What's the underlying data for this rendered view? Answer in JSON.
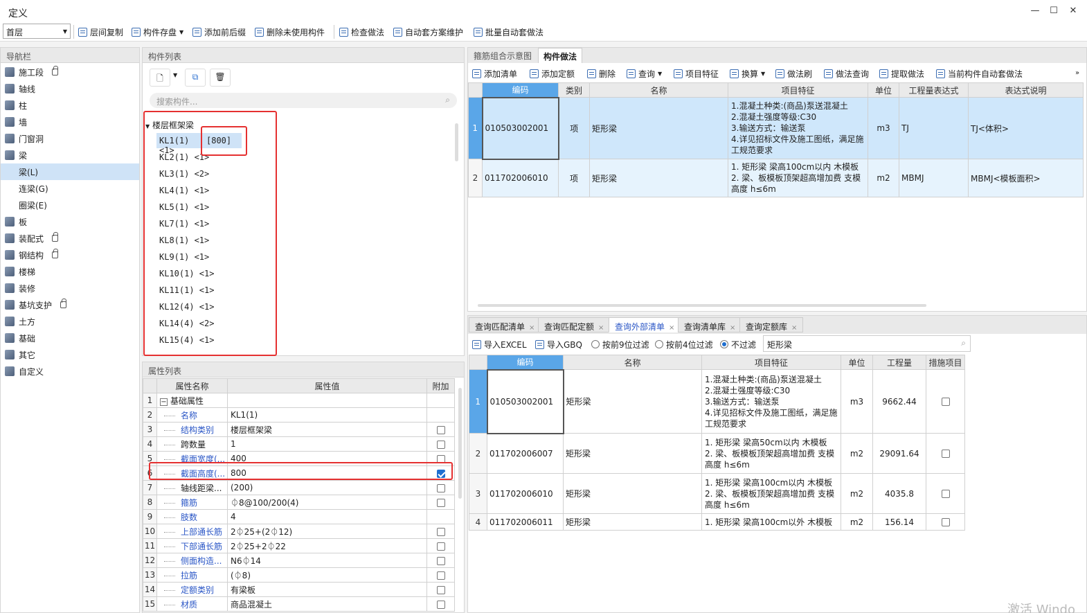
{
  "window": {
    "title": "定义"
  },
  "toolbar": {
    "floor_select": "首层",
    "buttons": [
      "层间复制",
      "构件存盘",
      "添加前后缀",
      "删除未使用构件",
      "检查做法",
      "自动套方案维护",
      "批量自动套做法"
    ]
  },
  "nav": {
    "title": "导航栏",
    "items": [
      {
        "label": "施工段",
        "lock": true,
        "sub": false,
        "selected": false
      },
      {
        "label": "轴线",
        "lock": false,
        "sub": false,
        "selected": false
      },
      {
        "label": "柱",
        "lock": false,
        "sub": false,
        "selected": false
      },
      {
        "label": "墙",
        "lock": false,
        "sub": false,
        "selected": false
      },
      {
        "label": "门窗洞",
        "lock": false,
        "sub": false,
        "selected": false
      },
      {
        "label": "梁",
        "lock": false,
        "sub": false,
        "selected": false
      },
      {
        "label": "梁(L)",
        "lock": false,
        "sub": true,
        "selected": true
      },
      {
        "label": "连梁(G)",
        "lock": false,
        "sub": true,
        "selected": false
      },
      {
        "label": "圈梁(E)",
        "lock": false,
        "sub": true,
        "selected": false
      },
      {
        "label": "板",
        "lock": false,
        "sub": false,
        "selected": false
      },
      {
        "label": "装配式",
        "lock": true,
        "sub": false,
        "selected": false
      },
      {
        "label": "钢结构",
        "lock": true,
        "sub": false,
        "selected": false
      },
      {
        "label": "楼梯",
        "lock": false,
        "sub": false,
        "selected": false
      },
      {
        "label": "装修",
        "lock": false,
        "sub": false,
        "selected": false
      },
      {
        "label": "基坑支护",
        "lock": true,
        "sub": false,
        "selected": false
      },
      {
        "label": "土方",
        "lock": false,
        "sub": false,
        "selected": false
      },
      {
        "label": "基础",
        "lock": false,
        "sub": false,
        "selected": false
      },
      {
        "label": "其它",
        "lock": false,
        "sub": false,
        "selected": false
      },
      {
        "label": "自定义",
        "lock": false,
        "sub": false,
        "selected": false
      }
    ]
  },
  "component_list": {
    "title": "构件列表",
    "search_placeholder": "搜索构件...",
    "group": "楼层框架梁",
    "selected_tag": "[800]",
    "items": [
      "KL1(1) <1>",
      "KL2(1) <1>",
      "KL3(1) <2>",
      "KL4(1) <1>",
      "KL5(1) <1>",
      "KL7(1) <1>",
      "KL8(1) <1>",
      "KL9(1) <1>",
      "KL10(1) <1>",
      "KL11(1) <1>",
      "KL12(4) <1>",
      "KL14(4) <2>",
      "KL15(4) <1>"
    ]
  },
  "props": {
    "title": "属性列表",
    "headers": [
      "属性名称",
      "属性值",
      "附加"
    ],
    "rows": [
      {
        "n": "1",
        "name": "基础属性",
        "val": "",
        "chk": "none",
        "blue": false,
        "group": true
      },
      {
        "n": "2",
        "name": "名称",
        "val": "KL1(1)",
        "chk": "none",
        "blue": true
      },
      {
        "n": "3",
        "name": "结构类别",
        "val": "楼层框架梁",
        "chk": "off",
        "blue": true
      },
      {
        "n": "4",
        "name": "跨数量",
        "val": "1",
        "chk": "off",
        "blue": false
      },
      {
        "n": "5",
        "name": "截面宽度(...",
        "val": "400",
        "chk": "off",
        "blue": true
      },
      {
        "n": "6",
        "name": "截面高度(...",
        "val": "800",
        "chk": "on",
        "blue": true
      },
      {
        "n": "7",
        "name": "轴线距梁...",
        "val": "(200)",
        "chk": "off",
        "blue": false
      },
      {
        "n": "8",
        "name": "箍筋",
        "val": "⏀8@100/200(4)",
        "chk": "off",
        "blue": true
      },
      {
        "n": "9",
        "name": "肢数",
        "val": "4",
        "chk": "none",
        "blue": true
      },
      {
        "n": "10",
        "name": "上部通长筋",
        "val": "2⏀25+(2⏀12)",
        "chk": "off",
        "blue": true
      },
      {
        "n": "11",
        "name": "下部通长筋",
        "val": "2⏀25+2⏀22",
        "chk": "off",
        "blue": true
      },
      {
        "n": "12",
        "name": "侧面构造...",
        "val": "N6⏀14",
        "chk": "off",
        "blue": true
      },
      {
        "n": "13",
        "name": "拉筋",
        "val": "(⏀8)",
        "chk": "off",
        "blue": true
      },
      {
        "n": "14",
        "name": "定额类别",
        "val": "有梁板",
        "chk": "off",
        "blue": true
      },
      {
        "n": "15",
        "name": "材质",
        "val": "商品混凝土",
        "chk": "off",
        "blue": true
      }
    ]
  },
  "method": {
    "tabs": [
      "箍筋组合示意图",
      "构件做法"
    ],
    "active_tab": 1,
    "buttons": [
      "添加清单",
      "添加定额",
      "删除",
      "查询",
      "项目特征",
      "换算",
      "做法刷",
      "做法查询",
      "提取做法",
      "当前构件自动套做法"
    ],
    "headers": [
      "编码",
      "类别",
      "名称",
      "项目特征",
      "单位",
      "工程量表达式",
      "表达式说明"
    ],
    "rows": [
      {
        "n": "1",
        "code": "010503002001",
        "cat": "项",
        "name": "矩形梁",
        "feat": "1.混凝土种类:(商品)泵送混凝土\n2.混凝土强度等级:C30\n3.输送方式：输送泵\n4.详见招标文件及施工图纸，满足施工规范要求",
        "unit": "m3",
        "expr": "TJ",
        "desc": "TJ<体积>"
      },
      {
        "n": "2",
        "code": "011702006010",
        "cat": "项",
        "name": "矩形梁",
        "feat": "1. 矩形梁 梁高100cm以内 木模板\n2. 梁、板模板顶架超高增加费 支模高度 h≤6m",
        "unit": "m2",
        "expr": "MBMJ",
        "desc": "MBMJ<模板面积>"
      }
    ]
  },
  "query": {
    "tabs": [
      "查询匹配清单",
      "查询匹配定额",
      "查询外部清单",
      "查询清单库",
      "查询定额库"
    ],
    "active_tab": 2,
    "import_excel": "导入EXCEL",
    "import_gbq": "导入GBQ",
    "filters": [
      "按前9位过滤",
      "按前4位过滤",
      "不过滤"
    ],
    "filter_selected": 2,
    "search_value": "矩形梁",
    "headers": [
      "编码",
      "名称",
      "项目特征",
      "单位",
      "工程量",
      "措施项目"
    ],
    "rows": [
      {
        "n": "1",
        "code": "010503002001",
        "name": "矩形梁",
        "feat": "1.混凝土种类:(商品)泵送混凝土\n2.混凝土强度等级:C30\n3.输送方式：输送泵\n4.详见招标文件及施工图纸，满足施工规范要求",
        "unit": "m3",
        "qty": "9662.44"
      },
      {
        "n": "2",
        "code": "011702006007",
        "name": "矩形梁",
        "feat": "1. 矩形梁 梁高50cm以内 木模板\n2. 梁、板模板顶架超高增加费 支模高度 h≤6m",
        "unit": "m2",
        "qty": "29091.64"
      },
      {
        "n": "3",
        "code": "011702006010",
        "name": "矩形梁",
        "feat": "1. 矩形梁 梁高100cm以内 木模板\n2. 梁、板模板顶架超高增加费 支模高度 h≤6m",
        "unit": "m2",
        "qty": "4035.8"
      },
      {
        "n": "4",
        "code": "011702006011",
        "name": "矩形梁",
        "feat": "1. 矩形梁 梁高100cm以外 木模板",
        "unit": "m2",
        "qty": "156.14"
      }
    ]
  },
  "watermark": "激活 Windo"
}
